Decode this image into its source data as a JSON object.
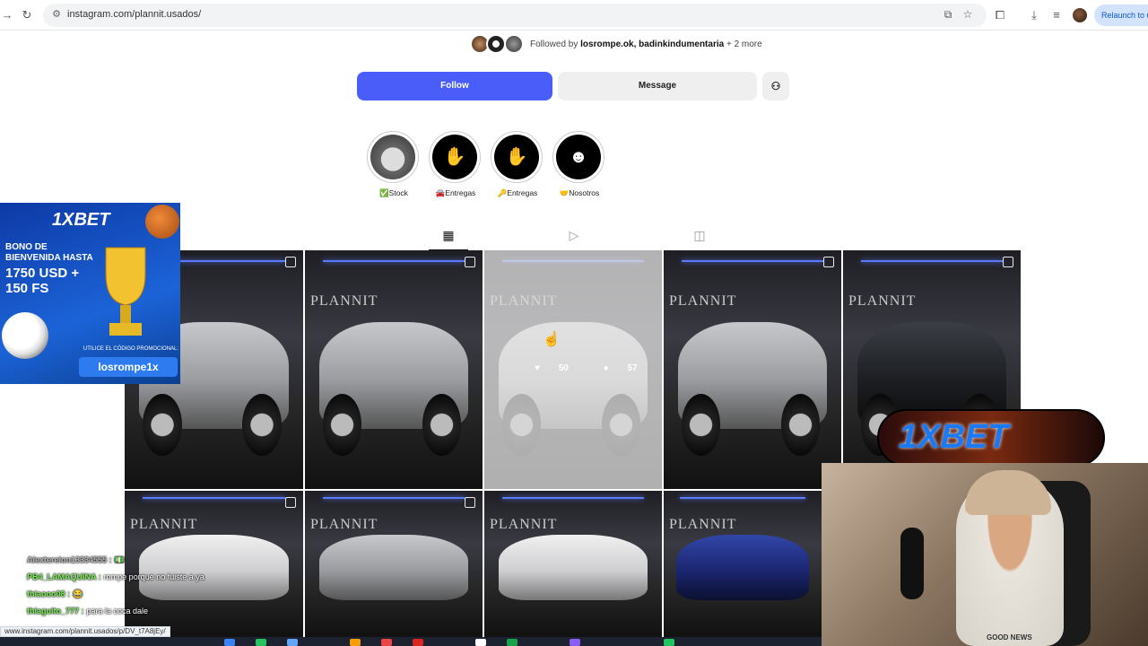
{
  "browser": {
    "url": "instagram.com/plannit.usados/",
    "relaunch_label": "Relaunch to u",
    "status_url": "www.instagram.com/plannit.usados/p/DV_t7A8jEy/"
  },
  "profile": {
    "followed_by_prefix": "Followed by ",
    "followed_by_users": "losrompe.ok, badinkindumentaria",
    "followed_by_more": " + 2 more",
    "follow_label": "Follow",
    "message_label": "Message",
    "add_user_icon": "add-user-icon"
  },
  "highlights": [
    {
      "label": "✅Stock",
      "icon": "car-icon"
    },
    {
      "label": "🚘Entregas",
      "icon": "key-hand-icon"
    },
    {
      "label": "🔑Entregas",
      "icon": "key-hand-icon"
    },
    {
      "label": "🤝Nosotros",
      "icon": "group-icon"
    }
  ],
  "tabs": [
    {
      "name": "posts",
      "icon": "grid-icon",
      "active": true
    },
    {
      "name": "reels",
      "icon": "reels-icon",
      "active": false
    },
    {
      "name": "tagged",
      "icon": "tagged-icon",
      "active": false
    }
  ],
  "grid": {
    "brand_text": "PLANNIT",
    "hovered_likes": "50",
    "hovered_comments": "57"
  },
  "ads": {
    "left_brand": "1XBET",
    "left_headline": "BONO DE BIENVENIDA HASTA",
    "left_amount": "1750 USD + 150 FS",
    "left_promo_caption": "UTILICE EL CÓDIGO PROMOCIONAL:",
    "left_promo_code": "losrompe1x",
    "right_brand": "1XBET"
  },
  "webcam": {
    "shirt_text": "GOOD NEWS"
  },
  "chat": [
    {
      "user": "Alextereion13334555 :",
      "message": "💵"
    },
    {
      "user": "PB4_LAMAQUINA :",
      "message": "rompe porque no fuiste a ya"
    },
    {
      "user": "thiaooo08 :",
      "message": "😂"
    },
    {
      "user": "thiaguito_777 :",
      "message": "para la coca dale"
    }
  ]
}
